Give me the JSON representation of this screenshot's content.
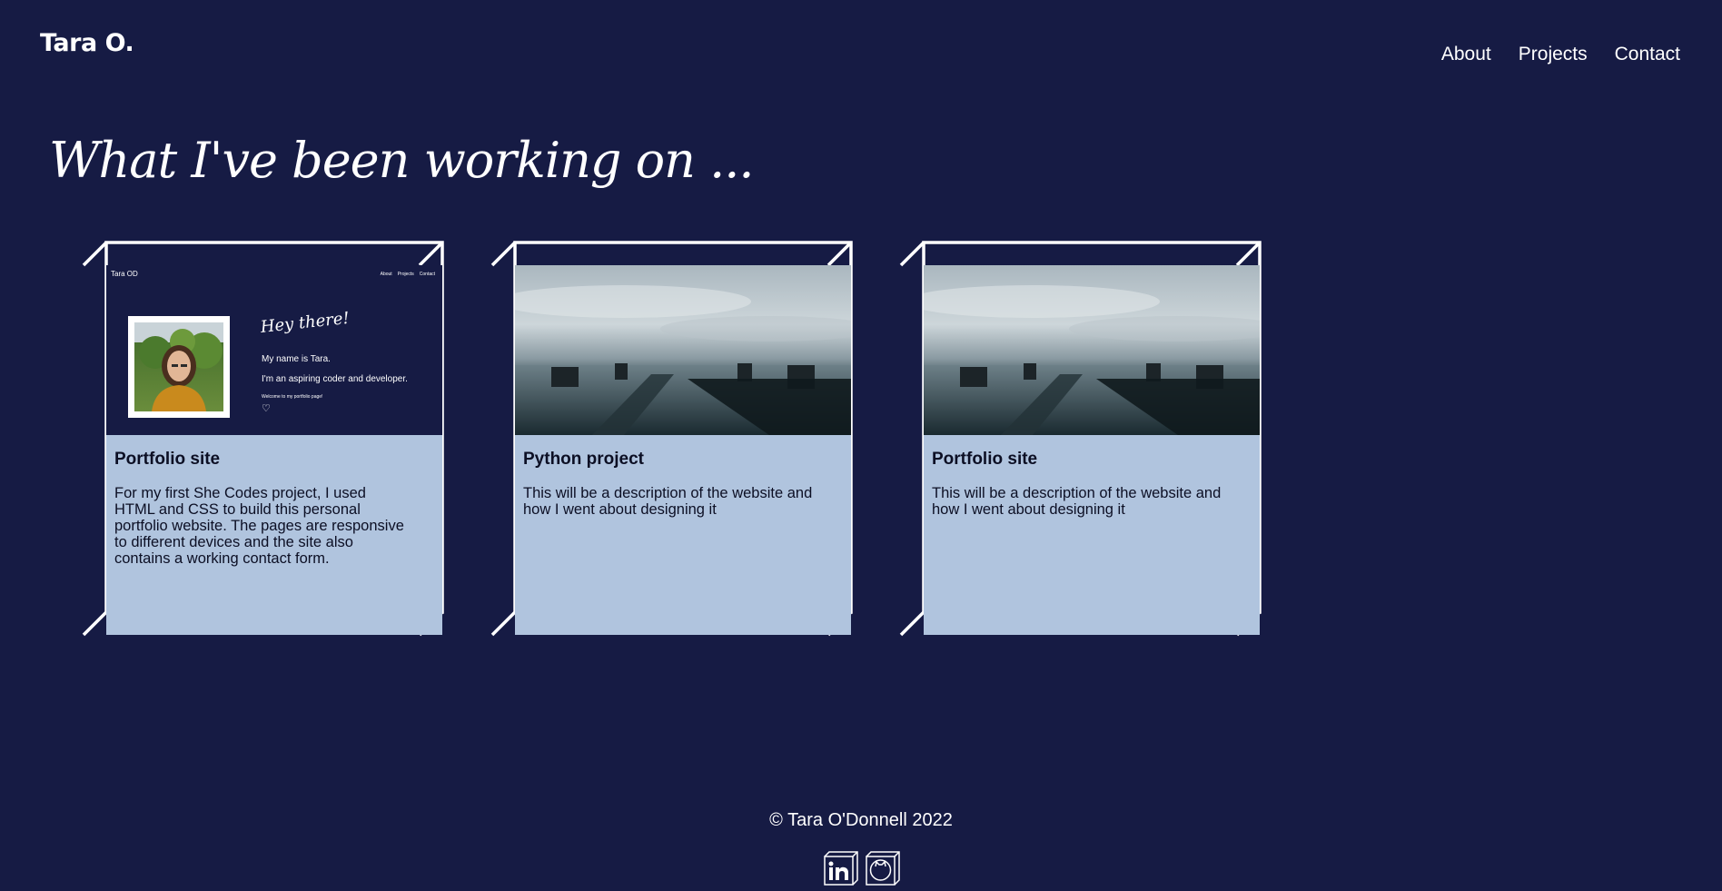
{
  "header": {
    "brand": "Tara O.",
    "nav": [
      "About",
      "Projects",
      "Contact"
    ]
  },
  "page": {
    "heading": "What I've been working on ..."
  },
  "projects": [
    {
      "title": "Portfolio site",
      "description": "For my first She Codes project, I used HTML and CSS to build this personal portfolio website. The pages are responsive to different devices and the site also contains a working contact form.",
      "thumbnail": "portfolio-screenshot",
      "preview": {
        "brand": "Tara OD",
        "nav": [
          "About",
          "Projects",
          "Contact"
        ],
        "greeting": "Hey there!",
        "line1": "My name is Tara.",
        "line2": "I'm an aspiring coder and developer.",
        "line3": "Welcome to my portfolio page!"
      }
    },
    {
      "title": "Python project",
      "description": "This will be a description of the website and how I went about designing it",
      "thumbnail": "pier-seascape-photo"
    },
    {
      "title": "Portfolio site",
      "description": "This will be a description of the website and how I went about designing it",
      "thumbnail": "pier-seascape-photo"
    }
  ],
  "footer": {
    "copyright": "© Tara O'Donnell 2022",
    "social_icons": [
      "linkedin-icon",
      "github-icon"
    ]
  },
  "colors": {
    "background": "#161b44",
    "card": "#b0c4de",
    "text_dark": "#0c0f24",
    "outline": "#ffffff"
  }
}
